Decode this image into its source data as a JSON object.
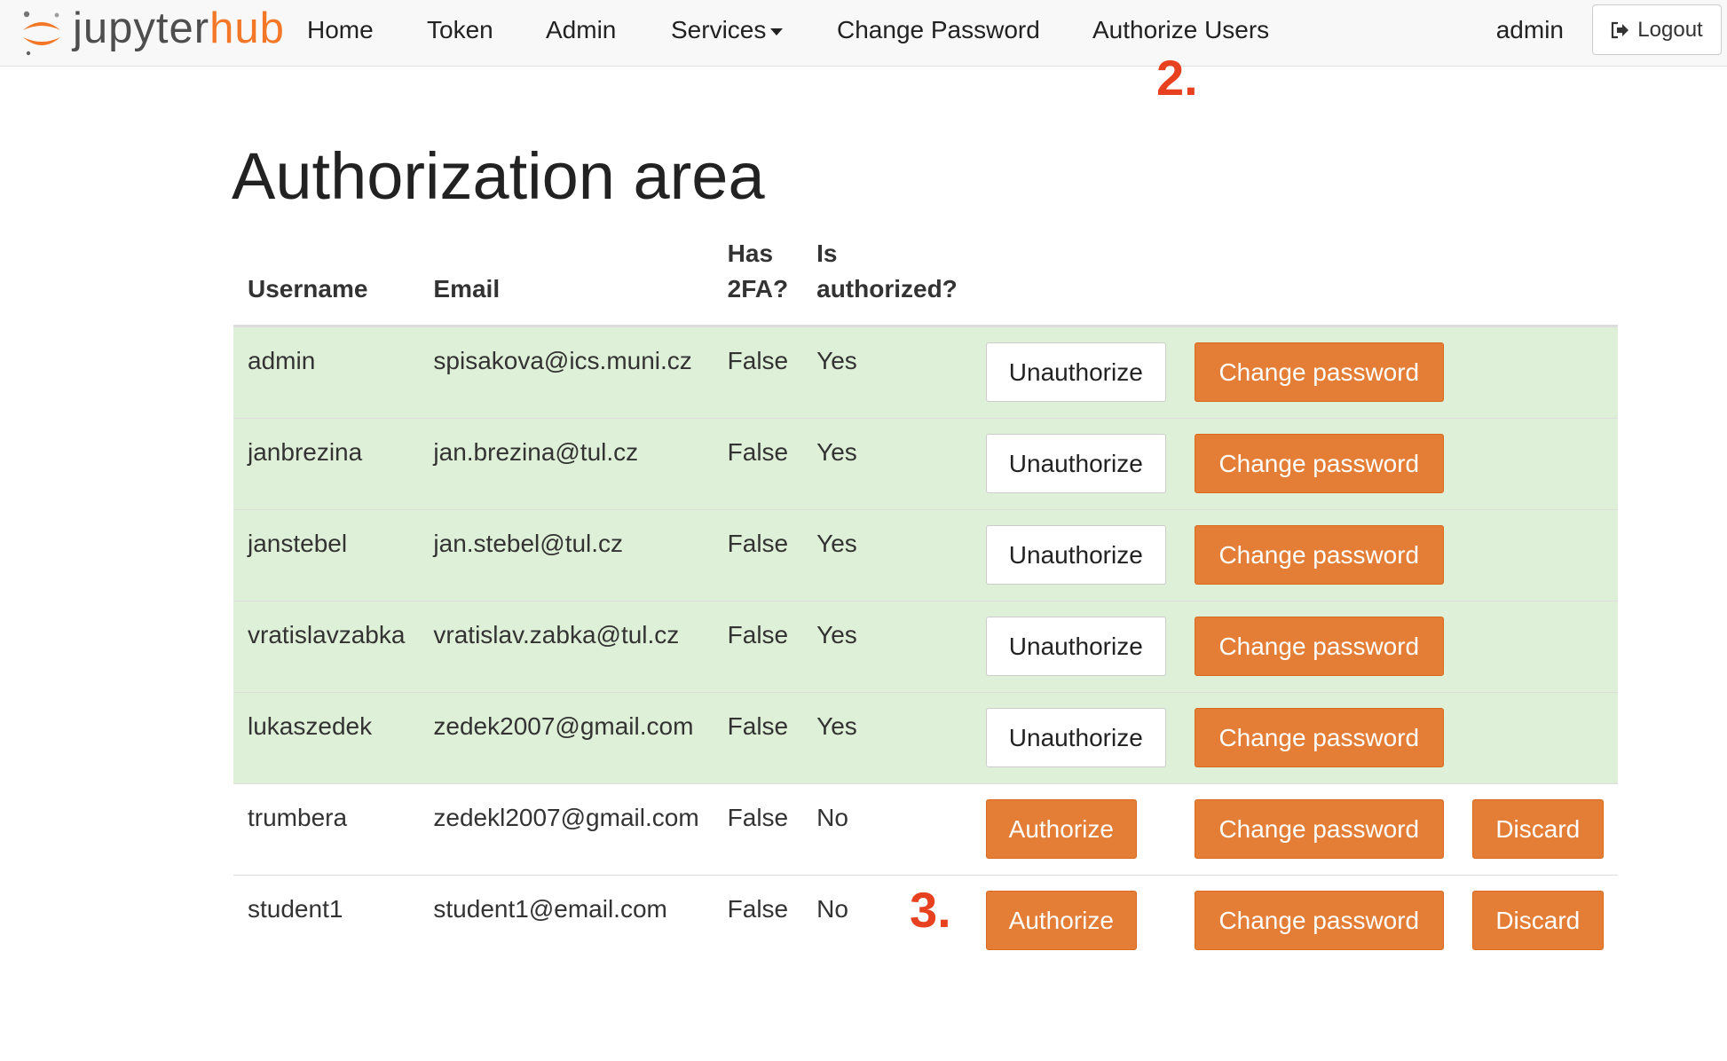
{
  "navbar": {
    "brand_jupyter": "jupyter",
    "brand_hub": "hub",
    "items": [
      {
        "label": "Home"
      },
      {
        "label": "Token"
      },
      {
        "label": "Admin"
      },
      {
        "label": "Services"
      },
      {
        "label": "Change Password"
      },
      {
        "label": "Authorize Users"
      }
    ],
    "user": "admin",
    "logout_label": "Logout"
  },
  "annotations": {
    "nav_marker": "2.",
    "row_marker": "3."
  },
  "page": {
    "title": "Authorization area"
  },
  "table": {
    "headers": {
      "username": "Username",
      "email": "Email",
      "has_2fa_line1": "Has",
      "has_2fa_line2": "2FA?",
      "is_authorized_line1": "Is",
      "is_authorized_line2": "authorized?"
    },
    "rows": [
      {
        "username": "admin",
        "email": "spisakova@ics.muni.cz",
        "has_2fa": "False",
        "authorized": "Yes",
        "action": "Unauthorize",
        "change": "Change password"
      },
      {
        "username": "janbrezina",
        "email": "jan.brezina@tul.cz",
        "has_2fa": "False",
        "authorized": "Yes",
        "action": "Unauthorize",
        "change": "Change password"
      },
      {
        "username": "janstebel",
        "email": "jan.stebel@tul.cz",
        "has_2fa": "False",
        "authorized": "Yes",
        "action": "Unauthorize",
        "change": "Change password"
      },
      {
        "username": "vratislavzabka",
        "email": "vratislav.zabka@tul.cz",
        "has_2fa": "False",
        "authorized": "Yes",
        "action": "Unauthorize",
        "change": "Change password"
      },
      {
        "username": "lukaszedek",
        "email": "zedek2007@gmail.com",
        "has_2fa": "False",
        "authorized": "Yes",
        "action": "Unauthorize",
        "change": "Change password"
      },
      {
        "username": "trumbera",
        "email": "zedekl2007@gmail.com",
        "has_2fa": "False",
        "authorized": "No",
        "action": "Authorize",
        "change": "Change password",
        "discard": "Discard"
      },
      {
        "username": "student1",
        "email": "student1@email.com",
        "has_2fa": "False",
        "authorized": "No",
        "action": "Authorize",
        "change": "Change password",
        "discard": "Discard"
      }
    ]
  },
  "colors": {
    "brand_orange": "#f37726",
    "button_orange": "#e47d35",
    "authorized_row_bg": "#dff0d8",
    "annotation_red": "#e8411f"
  }
}
